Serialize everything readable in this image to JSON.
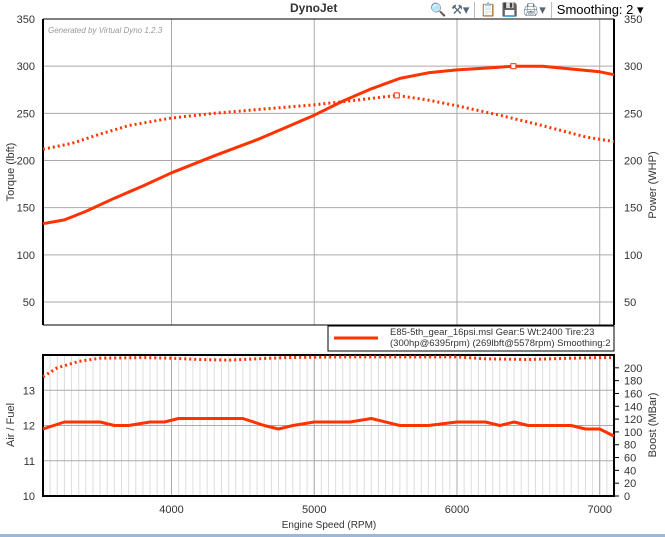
{
  "window": {
    "title": "DynoJet"
  },
  "toolbar": {
    "zoom_icon": "zoom-out-icon",
    "settings_icon": "settings-icon",
    "clipboard_icon": "clipboard-icon",
    "save_icon": "save-icon",
    "print_icon": "print-icon",
    "smoothing_label": "Smoothing: 2"
  },
  "watermark": "Generated by Virtual Dyno 1.2.3",
  "legend": {
    "line1": "E85-5th_gear_16psi.msl Gear:5 Wt:2400 Tire:23",
    "line2": "(300hp@6395rpm) (269lbft@5578rpm) Smoothing:2"
  },
  "chart_data": [
    {
      "type": "line",
      "title": "DynoJet",
      "xlabel": "Engine Speed (RPM)",
      "ylabel": "Torque (lbft)",
      "y2label": "Power (WHP)",
      "xlim": [
        3100,
        7100
      ],
      "ylim": [
        25,
        350
      ],
      "xticks": [
        4000,
        5000,
        6000,
        7000
      ],
      "yticks": [
        50,
        100,
        150,
        200,
        250,
        300,
        350
      ],
      "series": [
        {
          "name": "Power (WHP)",
          "style": "solid",
          "color": "#ff3300",
          "x": [
            3100,
            3250,
            3400,
            3600,
            3800,
            4000,
            4300,
            4600,
            4800,
            5000,
            5200,
            5400,
            5600,
            5800,
            6000,
            6200,
            6395,
            6600,
            6800,
            7000,
            7100
          ],
          "y": [
            133,
            137,
            146,
            160,
            173,
            187,
            205,
            222,
            235,
            248,
            263,
            276,
            287,
            293,
            296,
            298,
            300,
            300,
            297,
            294,
            291
          ],
          "marker": {
            "x": 6395,
            "y": 300
          }
        },
        {
          "name": "Torque (lbft)",
          "style": "dotted",
          "color": "#ff3300",
          "x": [
            3100,
            3300,
            3500,
            3700,
            4000,
            4300,
            4600,
            5000,
            5300,
            5578,
            5800,
            6000,
            6300,
            6600,
            6900,
            7100
          ],
          "y": [
            212,
            218,
            228,
            237,
            245,
            250,
            254,
            259,
            264,
            269,
            264,
            258,
            248,
            237,
            225,
            220
          ],
          "marker": {
            "x": 5578,
            "y": 269
          }
        }
      ]
    },
    {
      "type": "line",
      "xlabel": "Engine Speed (RPM)",
      "ylabel": "Air / Fuel",
      "y2label": "Boost (MBar)",
      "xlim": [
        3100,
        7100
      ],
      "ylim": [
        10,
        14
      ],
      "y2lim": [
        0,
        220
      ],
      "xticks": [
        4000,
        5000,
        6000,
        7000
      ],
      "yticks": [
        10,
        11,
        12,
        13
      ],
      "y2ticks": [
        0,
        20,
        40,
        60,
        80,
        100,
        120,
        140,
        160,
        180,
        200
      ],
      "series": [
        {
          "name": "Air / Fuel",
          "axis": "left",
          "style": "solid",
          "color": "#ff3300",
          "x": [
            3100,
            3250,
            3350,
            3500,
            3600,
            3700,
            3850,
            3950,
            4050,
            4200,
            4400,
            4500,
            4650,
            4750,
            4850,
            5000,
            5250,
            5400,
            5600,
            5800,
            6000,
            6200,
            6300,
            6400,
            6500,
            6700,
            6800,
            6900,
            7000,
            7100
          ],
          "y": [
            11.9,
            12.1,
            12.1,
            12.1,
            12.0,
            12.0,
            12.1,
            12.1,
            12.2,
            12.2,
            12.2,
            12.2,
            12.0,
            11.9,
            12.0,
            12.1,
            12.1,
            12.2,
            12.0,
            12.0,
            12.1,
            12.1,
            12.0,
            12.1,
            12.0,
            12.0,
            12.0,
            11.9,
            11.9,
            11.7
          ]
        },
        {
          "name": "Boost (MBar)",
          "axis": "right",
          "style": "dotted",
          "color": "#ff3300",
          "x": [
            3100,
            3200,
            3350,
            3500,
            3800,
            4000,
            4200,
            4400,
            4600,
            4800,
            5200,
            5600,
            6000,
            6200,
            6500,
            6800,
            7000,
            7100
          ],
          "y": [
            186,
            200,
            210,
            215,
            216,
            215,
            213,
            212,
            214,
            216,
            217,
            217,
            217,
            214,
            213,
            215,
            216,
            216
          ]
        }
      ]
    }
  ]
}
